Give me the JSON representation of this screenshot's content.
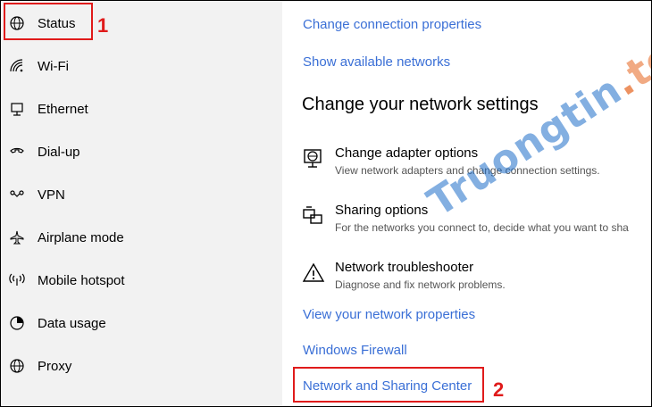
{
  "sidebar": {
    "items": [
      {
        "label": "Status",
        "icon": "globe-status-icon"
      },
      {
        "label": "Wi-Fi",
        "icon": "wifi-icon"
      },
      {
        "label": "Ethernet",
        "icon": "ethernet-icon"
      },
      {
        "label": "Dial-up",
        "icon": "dialup-icon"
      },
      {
        "label": "VPN",
        "icon": "vpn-icon"
      },
      {
        "label": "Airplane mode",
        "icon": "airplane-icon"
      },
      {
        "label": "Mobile hotspot",
        "icon": "hotspot-icon"
      },
      {
        "label": "Data usage",
        "icon": "data-usage-icon"
      },
      {
        "label": "Proxy",
        "icon": "globe-icon"
      }
    ]
  },
  "main": {
    "top_links": [
      "Change connection properties",
      "Show available networks"
    ],
    "section_title": "Change your network settings",
    "options": [
      {
        "title": "Change adapter options",
        "desc": "View network adapters and change connection settings.",
        "icon": "adapter-globe-icon"
      },
      {
        "title": "Sharing options",
        "desc": "For the networks you connect to, decide what you want to sha",
        "icon": "sharing-icon"
      },
      {
        "title": "Network troubleshooter",
        "desc": "Diagnose and fix network problems.",
        "icon": "warning-icon"
      }
    ],
    "bottom_links": [
      "View your network properties",
      "Windows Firewall",
      "Network and Sharing Center"
    ]
  },
  "annotations": {
    "step1": "1",
    "step2": "2"
  },
  "watermark": {
    "main": "Truongtin",
    "dot": ".",
    "tail": "top"
  },
  "colors": {
    "link": "#3a6fd6",
    "callout": "#e01b1b",
    "sidebar_bg": "#f2f2f2"
  }
}
